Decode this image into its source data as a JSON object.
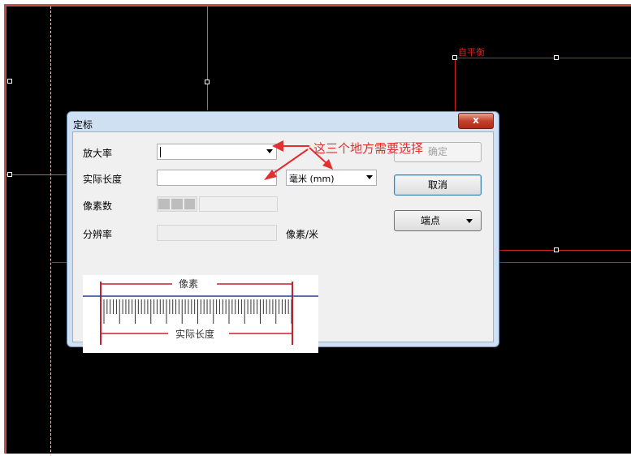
{
  "canvas": {
    "overlay_label": "自平衡"
  },
  "dialog": {
    "title": "定标",
    "close_label": "x",
    "magnification": {
      "label": "放大率",
      "value": ""
    },
    "actual_length": {
      "label": "实际长度",
      "value": ""
    },
    "unit_select": {
      "value": "毫米 (mm)"
    },
    "pixel_count": {
      "label": "像素数"
    },
    "resolution": {
      "label": "分辨率",
      "unit": "像素/米"
    },
    "ok_label": "确定",
    "cancel_label": "取消",
    "endpoint_label": "端点",
    "annotation": "这三个地方需要选择",
    "diagram": {
      "top_label": "像素",
      "bottom_label": "实际长度"
    }
  },
  "colors": {
    "accent_red": "#e03030",
    "guide_green": "#20c020",
    "canvas_bg": "#000000"
  }
}
